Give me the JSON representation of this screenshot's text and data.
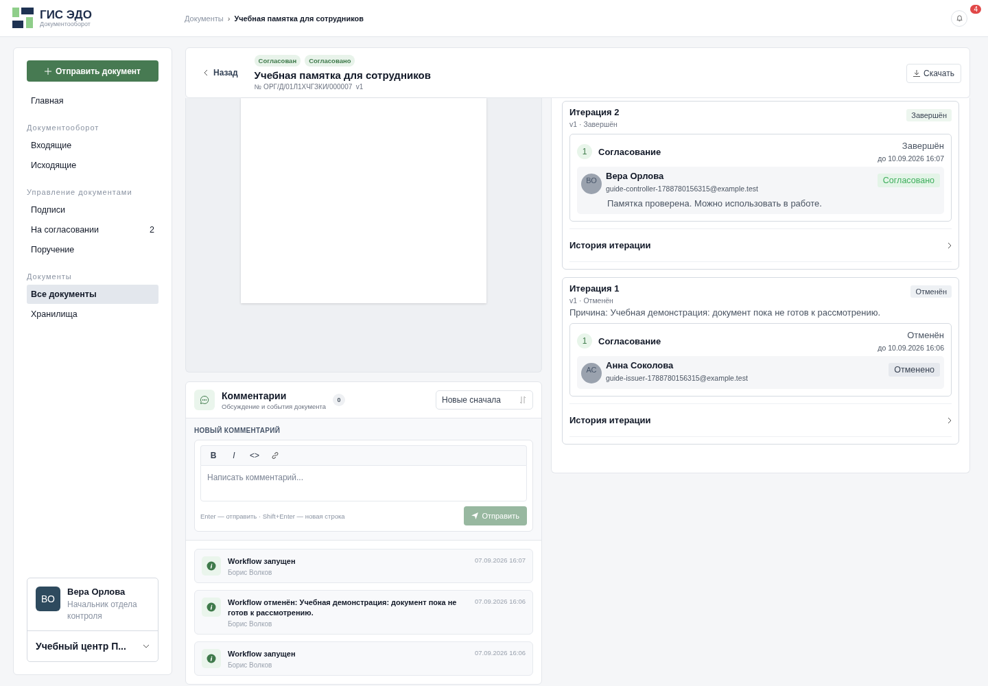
{
  "app": {
    "logo_title": "ГИС ЭДО",
    "logo_subtitle": "Документооборот",
    "notifications": "4"
  },
  "breadcrumb_separator": "›",
  "breadcrumbs": [
    {
      "label": "Документы",
      "current": false
    },
    {
      "label": "Учебная памятка для сотрудников",
      "current": true
    }
  ],
  "sidebar": {
    "primary_button": "Отправить документ",
    "sections": [
      {
        "items": [
          {
            "label": "Главная",
            "selected": false
          }
        ]
      },
      {
        "title": "Документооборот",
        "items": [
          {
            "label": "Входящие",
            "selected": false
          },
          {
            "label": "Исходящие",
            "selected": false
          }
        ]
      },
      {
        "title": "Управление документами",
        "items": [
          {
            "label": "Подписи",
            "selected": false
          },
          {
            "label": "На согласовании",
            "selected": false,
            "count": "2"
          },
          {
            "label": "Поручение",
            "selected": false
          }
        ]
      },
      {
        "title": "Документы",
        "items": [
          {
            "label": "Все документы",
            "selected": true
          },
          {
            "label": "Хранилища",
            "selected": false
          }
        ]
      }
    ],
    "user": {
      "initials": "ВО",
      "name": "Вера Орлова",
      "role": "Начальник отдела контроля",
      "organization": "Учебный центр П..."
    }
  },
  "document": {
    "back": "Назад",
    "tags": [
      "Согласован",
      "Согласовано"
    ],
    "title": "Учебная памятка для сотрудников",
    "number": "№ ОРГ/Д/01Л1ХЧГЗКИ/000007  v1",
    "download": "Скачать"
  },
  "iterations": [
    {
      "title": "Итерация 2",
      "meta": "v1 · Завершён",
      "status": "Завершён",
      "stages": [
        {
          "number": "1",
          "name": "Согласование",
          "status": "Завершён",
          "deadline": "до 10.09.2026 16:07",
          "approvers": [
            {
              "initials": "ВО",
              "name": "Вера Орлова",
              "email": "guide-controller-1788780156315@example.test",
              "decision": "Согласовано",
              "kind": "approved",
              "comment": "Памятка проверена. Можно использовать в работе."
            }
          ]
        }
      ],
      "history": "История итерации"
    },
    {
      "title": "Итерация 1",
      "meta": "v1 · Отменён",
      "status": "Отменён",
      "reason": "Причина: Учебная демонстрация: документ пока не готов к рассмотрению.",
      "stages": [
        {
          "number": "1",
          "name": "Согласование",
          "status": "Отменён",
          "deadline": "до 10.09.2026 16:06",
          "approvers": [
            {
              "initials": "АС",
              "name": "Анна Соколова",
              "email": "guide-issuer-1788780156315@example.test",
              "decision": "Отменено",
              "kind": "cancelled"
            }
          ]
        }
      ],
      "history": "История итерации"
    }
  ],
  "comments": {
    "title": "Комментарии",
    "subtitle": "Обсуждение и события документа",
    "count": "0",
    "sort": "Новые сначала",
    "new_label": "НОВЫЙ КОММЕНТАРИЙ",
    "toolbar": [
      {
        "kind": "bold",
        "label": "B"
      },
      {
        "kind": "italic",
        "label": "I"
      },
      {
        "kind": "code",
        "label": "<>"
      },
      {
        "kind": "link"
      }
    ],
    "placeholder": "Написать комментарий...",
    "hint": "Enter — отправить · Shift+Enter — новая строка",
    "send": "Отправить",
    "send_disabled": true,
    "events": [
      {
        "title": "Workflow запущен",
        "author": "Борис Волков",
        "time": "07.09.2026 16:07"
      },
      {
        "title": "Workflow отменён: Учебная демонстрация: документ пока не готов к рассмотрению.",
        "author": "Борис Волков",
        "time": "07.09.2026 16:06"
      },
      {
        "title": "Workflow запущен",
        "author": "Борис Волков",
        "time": "07.09.2026 16:06"
      }
    ]
  }
}
